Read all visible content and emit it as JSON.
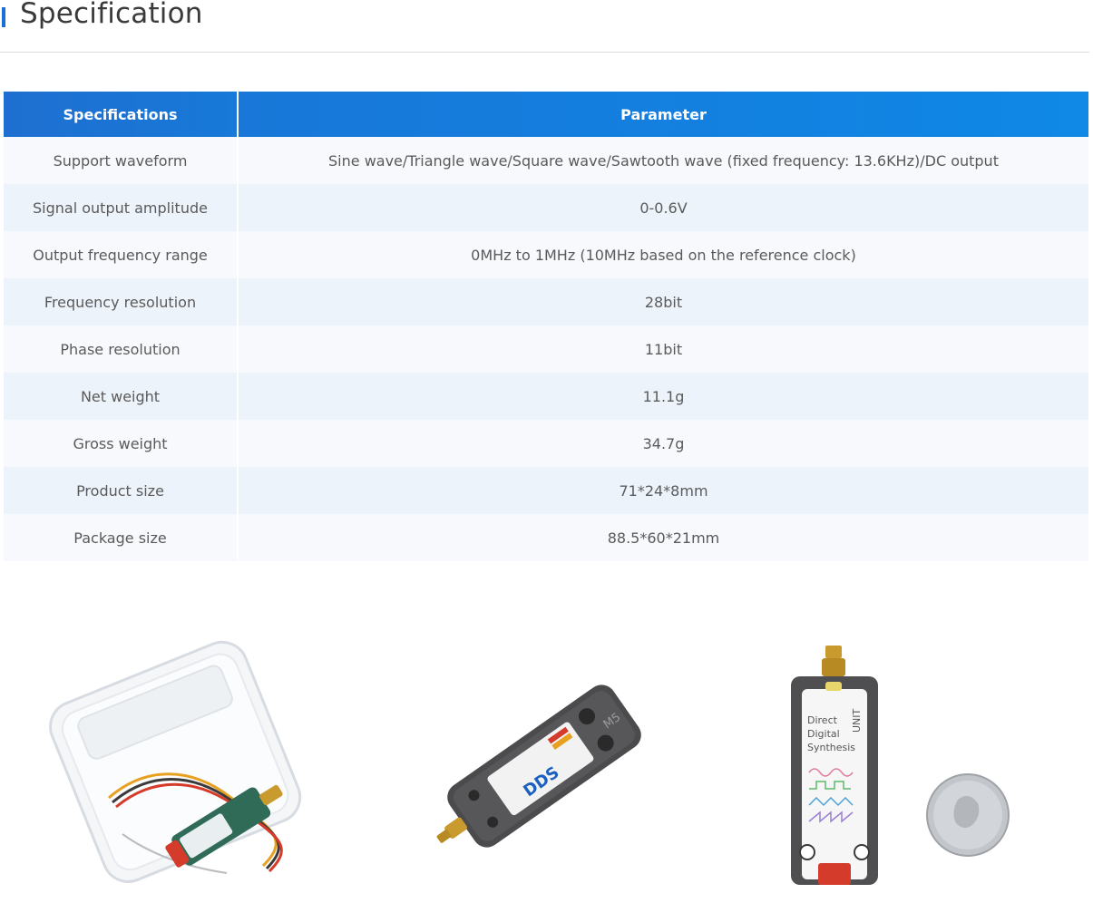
{
  "page": {
    "title": "Specification"
  },
  "table": {
    "headers": [
      "Specifications",
      "Parameter"
    ],
    "rows": [
      [
        "Support waveform",
        "Sine wave/Triangle wave/Square wave/Sawtooth wave (fixed frequency: 13.6KHz)/DC output"
      ],
      [
        "Signal output amplitude",
        "0-0.6V"
      ],
      [
        "Output frequency range",
        "0MHz to 1MHz (10MHz based on the reference clock)"
      ],
      [
        "Frequency resolution",
        "28bit"
      ],
      [
        "Phase resolution",
        "11bit"
      ],
      [
        "Net weight",
        "11.1g"
      ],
      [
        "Gross weight",
        "34.7g"
      ],
      [
        "Product size",
        "71*24*8mm"
      ],
      [
        "Package size",
        "88.5*60*21mm"
      ]
    ]
  },
  "images": {
    "unit_front": {
      "brand": "M5",
      "label_lines": [
        "Direct",
        "Digital",
        "Synthesis"
      ],
      "unit_word": "UNIT",
      "logo": "DDS"
    },
    "accent_color": "#1a6fd6"
  }
}
